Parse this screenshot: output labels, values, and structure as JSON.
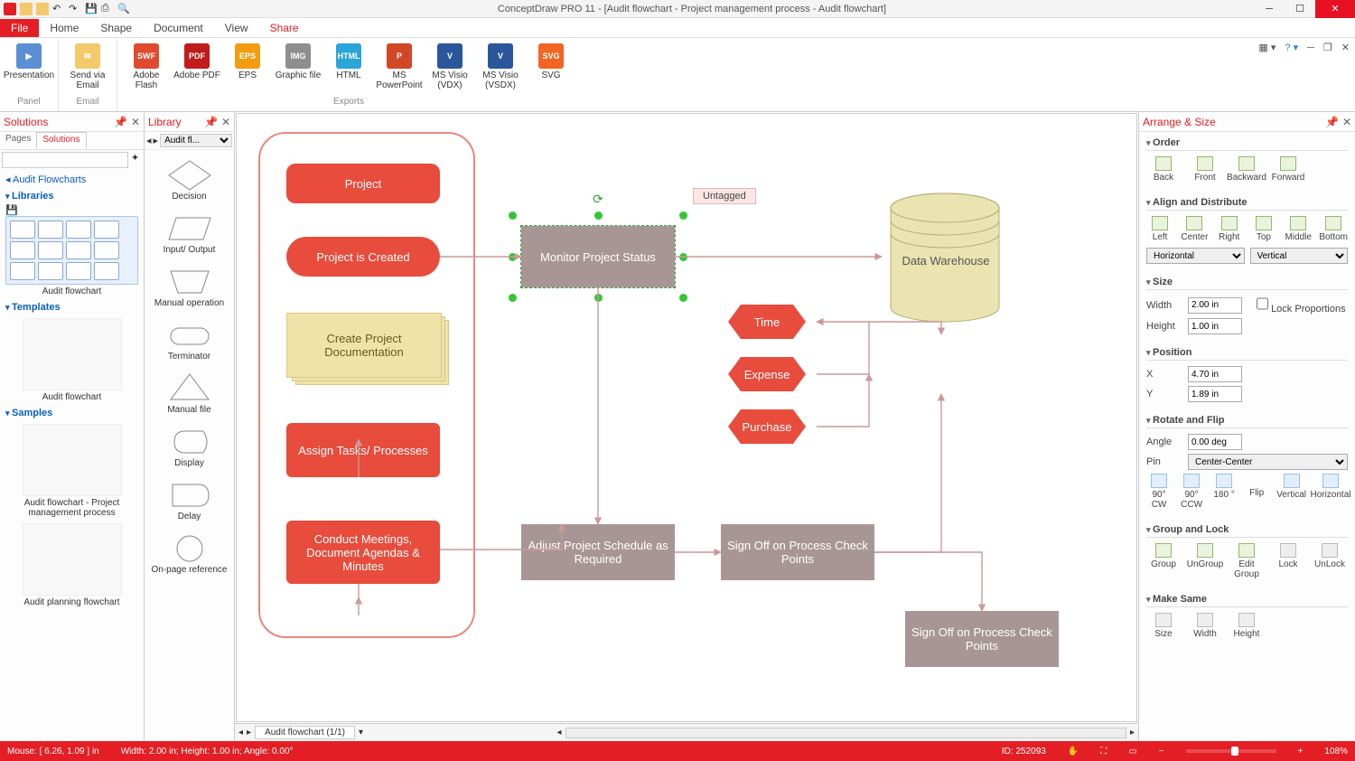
{
  "title": "ConceptDraw PRO 11 - [Audit flowchart - Project management process - Audit flowchart]",
  "menu": {
    "file": "File",
    "home": "Home",
    "shape": "Shape",
    "document": "Document",
    "view": "View",
    "share": "Share"
  },
  "ribbon": {
    "panel": {
      "label": "Panel",
      "presentation": "Presentation"
    },
    "email": {
      "label": "Email",
      "send": "Send via Email"
    },
    "exports": {
      "label": "Exports",
      "items": [
        {
          "label": "Adobe Flash",
          "ic": "SWF",
          "bg": "#e04a2f"
        },
        {
          "label": "Adobe PDF",
          "ic": "PDF",
          "bg": "#c11b1b"
        },
        {
          "label": "EPS",
          "ic": "EPS",
          "bg": "#f39c12"
        },
        {
          "label": "Graphic file",
          "ic": "IMG",
          "bg": "#8e8e8e"
        },
        {
          "label": "HTML",
          "ic": "HTML",
          "bg": "#2aa5d8"
        },
        {
          "label": "MS PowerPoint",
          "ic": "P",
          "bg": "#d24726"
        },
        {
          "label": "MS Visio (VDX)",
          "ic": "V",
          "bg": "#2b579a"
        },
        {
          "label": "MS Visio (VSDX)",
          "ic": "V",
          "bg": "#2b579a"
        },
        {
          "label": "SVG",
          "ic": "SVG",
          "bg": "#f26522"
        }
      ]
    }
  },
  "solutions": {
    "title": "Solutions",
    "tabs": {
      "pages": "Pages",
      "solutions": "Solutions"
    },
    "root": "Audit Flowcharts",
    "libraries_h": "Libraries",
    "lib_name": "Audit flowchart",
    "templates_h": "Templates",
    "template_name": "Audit flowchart",
    "samples_h": "Samples",
    "sample1": "Audit flowchart - Project management process",
    "sample2": "Audit planning flowchart"
  },
  "library": {
    "title": "Library",
    "selected": "Audit fl...",
    "shapes": [
      "Decision",
      "Input/ Output",
      "Manual operation",
      "Terminator",
      "Manual file",
      "Display",
      "Delay",
      "On-page reference"
    ]
  },
  "flow": {
    "project": "Project",
    "created": "Project is Created",
    "docs": "Create Project Documentation",
    "assign": "Assign Tasks/ Processes",
    "meetings": "Conduct Meetings, Document Agendas & Minutes",
    "monitor": "Monitor Project Status",
    "untagged": "Untagged",
    "time": "Time",
    "expense": "Expense",
    "purchase": "Purchase",
    "adjust": "Adjust Project Schedule as Required",
    "signoff1": "Sign Off on Process Check Points",
    "signoff2": "Sign Off on Process Check Points",
    "warehouse": "Data Warehouse"
  },
  "doc_tabs": {
    "tab": "Audit flowchart (1/1)"
  },
  "arrange": {
    "title": "Arrange & Size",
    "order": {
      "h": "Order",
      "back": "Back",
      "front": "Front",
      "backward": "Backward",
      "forward": "Forward"
    },
    "align": {
      "h": "Align and Distribute",
      "left": "Left",
      "center": "Center",
      "right": "Right",
      "top": "Top",
      "middle": "Middle",
      "bottom": "Bottom",
      "horizontal": "Horizontal",
      "vertical": "Vertical"
    },
    "size": {
      "h": "Size",
      "width_l": "Width",
      "width": "2.00 in",
      "height_l": "Height",
      "height": "1.00 in",
      "lock": "Lock Proportions"
    },
    "pos": {
      "h": "Position",
      "x_l": "X",
      "x": "4.70 in",
      "y_l": "Y",
      "y": "1.89 in"
    },
    "rot": {
      "h": "Rotate and Flip",
      "angle_l": "Angle",
      "angle": "0.00 deg",
      "pin_l": "Pin",
      "pin": "Center-Center",
      "cw": "90° CW",
      "ccw": "90° CCW",
      "r180": "180 °",
      "flip": "Flip",
      "vert": "Vertical",
      "horiz": "Horizontal"
    },
    "group": {
      "h": "Group and Lock",
      "group": "Group",
      "ungroup": "UnGroup",
      "edit": "Edit Group",
      "lock": "Lock",
      "unlock": "UnLock"
    },
    "same": {
      "h": "Make Same",
      "size": "Size",
      "width": "Width",
      "height": "Height"
    }
  },
  "status": {
    "mouse": "Mouse: [ 6.26, 1.09 ] in",
    "dims": "Width: 2.00 in;  Height: 1.00 in;  Angle: 0.00°",
    "id": "ID: 252093",
    "zoom": "108%"
  }
}
